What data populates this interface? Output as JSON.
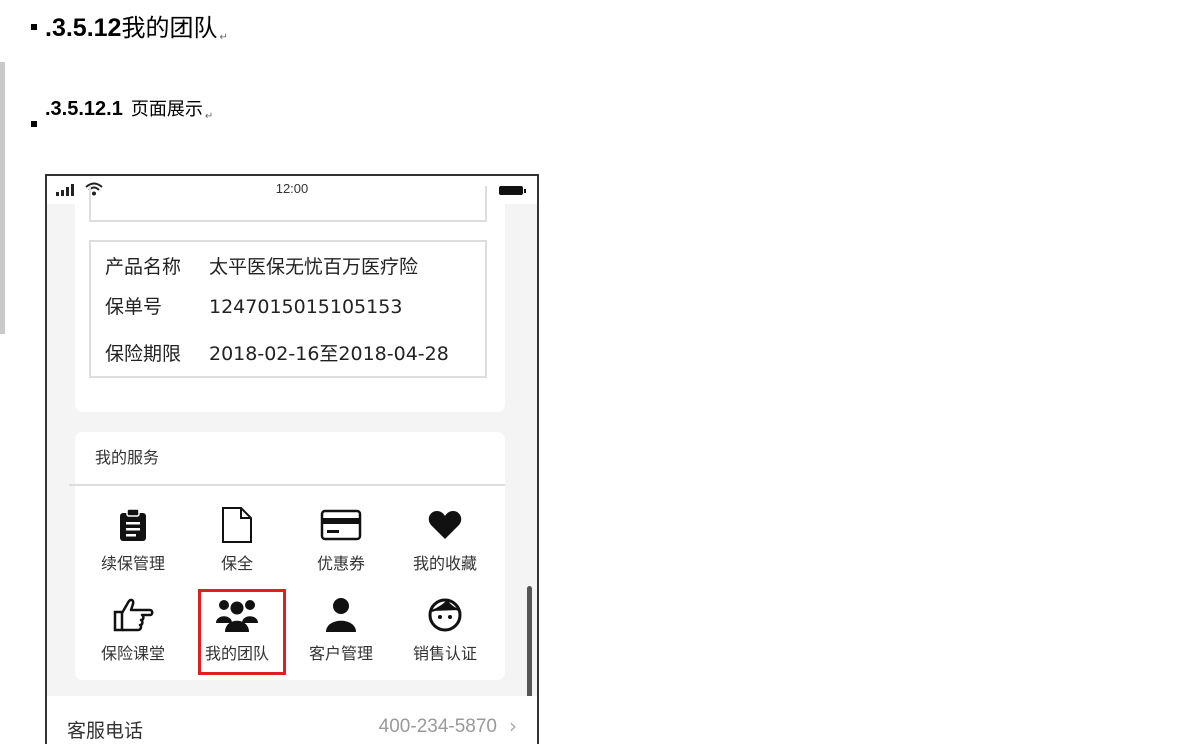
{
  "doc": {
    "heading3": {
      "number": ".3.5.12",
      "title": "我的团队"
    },
    "heading4": {
      "number": ".3.5.12.1",
      "title": "页面展示"
    },
    "paragraph_mark": "↵"
  },
  "phone": {
    "status_bar": {
      "time": "12:00"
    },
    "policy_info": {
      "rows": [
        {
          "label": "产品名称",
          "value": "太平医保无忧百万医疗险"
        },
        {
          "label": "保单号",
          "value": "1247015015105153"
        },
        {
          "label": "保险期限",
          "value": "2018-02-16至2018-04-28"
        }
      ]
    },
    "services": {
      "title": "我的服务",
      "items": [
        {
          "label": "续保管理",
          "icon": "clipboard-icon"
        },
        {
          "label": "保全",
          "icon": "document-icon"
        },
        {
          "label": "优惠券",
          "icon": "card-icon"
        },
        {
          "label": "我的收藏",
          "icon": "heart-icon"
        },
        {
          "label": "保险课堂",
          "icon": "thumb-pointing-icon"
        },
        {
          "label": "我的团队",
          "icon": "team-icon"
        },
        {
          "label": "客户管理",
          "icon": "user-icon"
        },
        {
          "label": "销售认证",
          "icon": "face-icon"
        }
      ],
      "highlighted_item": "我的团队",
      "highlight_color": "#e02020"
    },
    "customer_service": {
      "label": "客服电话",
      "value": "400-234-5870",
      "chevron": "›"
    }
  }
}
